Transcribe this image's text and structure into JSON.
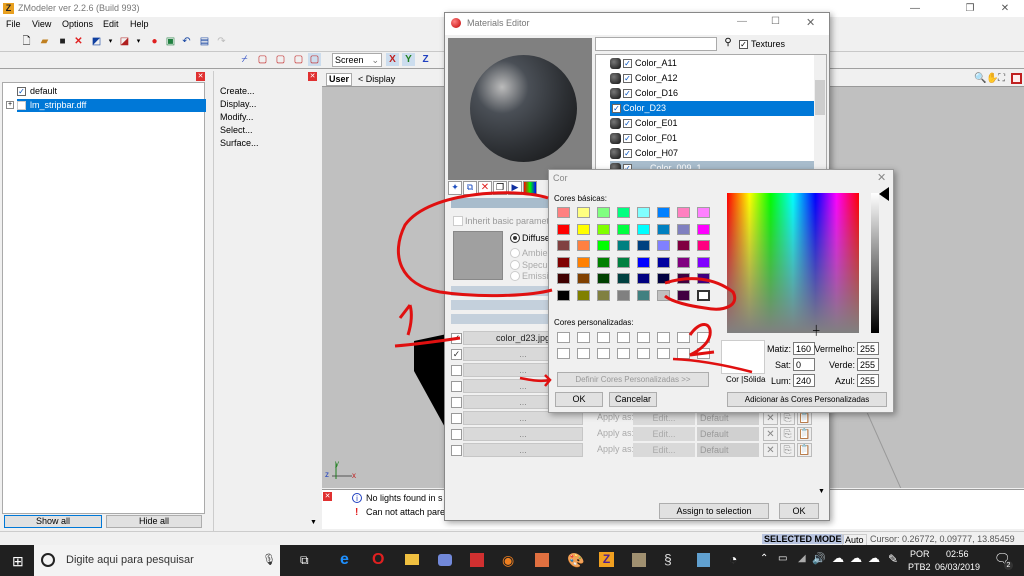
{
  "app": {
    "title": "ZModeler ver 2.2.6 (Build 993)",
    "menu": [
      "File",
      "View",
      "Options",
      "Edit",
      "Help"
    ]
  },
  "toolbar": {
    "coord_mode": "Screen",
    "axes": [
      "X",
      "Y",
      "Z"
    ]
  },
  "scene_tree": {
    "items": [
      {
        "label": "default",
        "checked": true,
        "selected": false
      },
      {
        "label": "lm_stripbar.dff",
        "checked": false,
        "selected": true
      }
    ],
    "show_all": "Show all",
    "hide_all": "Hide all"
  },
  "command_panel": {
    "items": [
      "Create...",
      "Display...",
      "Modify...",
      "Select...",
      "Surface..."
    ]
  },
  "viewport": {
    "view_name": "User",
    "display_label": "< Display",
    "axis_labels": [
      "z",
      "y",
      "x"
    ]
  },
  "log": {
    "messages": [
      {
        "type": "info",
        "text": "No lights found in s"
      },
      {
        "type": "error",
        "text": "Can not attach pare"
      }
    ]
  },
  "status": {
    "mode": "SELECTED MODE",
    "auto": "Auto",
    "cursor": "Cursor: 0.26772, 0.09777, 13.85459"
  },
  "materials_editor": {
    "title": "Materials Editor",
    "search_value": "",
    "textures_label": "Textures",
    "textures_checked": true,
    "materials": [
      {
        "label": "Color_A11",
        "checked": true,
        "selected": false
      },
      {
        "label": "Color_A12",
        "checked": true,
        "selected": false
      },
      {
        "label": "Color_D16",
        "checked": true,
        "selected": false
      },
      {
        "label": "Color_D23",
        "checked": true,
        "selected": true
      },
      {
        "label": "Color_E01",
        "checked": true,
        "selected": false
      },
      {
        "label": "Color_F01",
        "checked": true,
        "selected": false
      },
      {
        "label": "Color_H07",
        "checked": true,
        "selected": false
      },
      {
        "label": "Color_009_1",
        "checked": true,
        "selected": false
      }
    ],
    "inherit_label": "Inherit basic parameters",
    "radio_options": [
      "Diffuse",
      "Ambient",
      "Specular",
      "Emissive"
    ],
    "radio_selected": "Diffuse",
    "textures": [
      {
        "checked": true,
        "name": "color_d23.jpg"
      },
      {
        "checked": true,
        "name": "..."
      },
      {
        "checked": false,
        "name": "..."
      },
      {
        "checked": false,
        "name": "..."
      },
      {
        "checked": false,
        "name": "..."
      },
      {
        "checked": false,
        "name": "...",
        "apply_as": "Apply as:",
        "edit": "Edit...",
        "mode": "Default"
      },
      {
        "checked": false,
        "name": "...",
        "apply_as": "Apply as:",
        "edit": "Edit...",
        "mode": "Default"
      },
      {
        "checked": false,
        "name": "...",
        "apply_as": "Apply as:",
        "edit": "Edit...",
        "mode": "Default"
      }
    ],
    "assign_button": "Assign to selection",
    "ok_button": "OK"
  },
  "color_dialog": {
    "title": "Cor",
    "basic_label": "Cores básicas:",
    "basic_colors": [
      "#ff8080",
      "#ffff80",
      "#80ff80",
      "#00ff80",
      "#80ffff",
      "#0080ff",
      "#ff80c0",
      "#ff80ff",
      "#ff0000",
      "#ffff00",
      "#80ff00",
      "#00ff40",
      "#00ffff",
      "#0080c0",
      "#8080c0",
      "#ff00ff",
      "#804040",
      "#ff8040",
      "#00ff00",
      "#008080",
      "#004080",
      "#8080ff",
      "#800040",
      "#ff0080",
      "#800000",
      "#ff8000",
      "#008000",
      "#008040",
      "#0000ff",
      "#0000a0",
      "#800080",
      "#8000ff",
      "#400000",
      "#804000",
      "#004000",
      "#004040",
      "#000080",
      "#000040",
      "#400040",
      "#400080",
      "#000000",
      "#808000",
      "#808040",
      "#808080",
      "#408080",
      "#c0c0c0",
      "#400040",
      "#ffffff"
    ],
    "custom_label": "Cores personalizadas:",
    "define_custom": "Definir Cores Personalizadas >>",
    "ok": "OK",
    "cancel": "Cancelar",
    "color_solid_label": "Cor |Sólida",
    "hue_label": "Matiz:",
    "hue": "160",
    "sat_label": "Sat:",
    "sat": "0",
    "lum_label": "Lum:",
    "lum": "240",
    "red_label": "Vermelho:",
    "red": "255",
    "green_label": "Verde:",
    "green": "255",
    "blue_label": "Azul:",
    "blue": "255",
    "add_custom": "Adicionar às Cores Personalizadas"
  },
  "annotations": [
    "1",
    "2"
  ],
  "taskbar": {
    "search_placeholder": "Digite aqui para pesquisar",
    "lang_top": "POR",
    "lang_bottom": "PTB2",
    "time": "02:56",
    "date": "06/03/2019",
    "notifications": "2"
  }
}
